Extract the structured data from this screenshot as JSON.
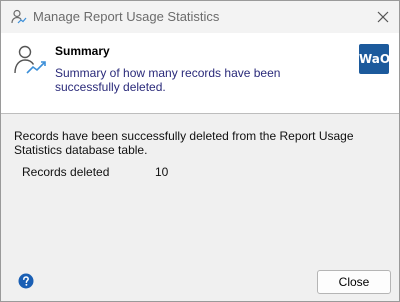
{
  "window": {
    "title": "Manage Report Usage Statistics"
  },
  "header": {
    "title": "Summary",
    "description": "Summary of how many records have been successfully deleted.",
    "logo_text": "WaO",
    "logo_color": "#1c5a9c",
    "icon": "user-chart-icon"
  },
  "body": {
    "message": "Records have been successfully deleted from the Report Usage Statistics database table.",
    "records_label": "Records deleted",
    "records_value": "10"
  },
  "footer": {
    "help_icon": "help-icon",
    "close_label": "Close"
  },
  "colors": {
    "help_blue": "#1a5fb4",
    "description_text": "#2a2a7a"
  }
}
